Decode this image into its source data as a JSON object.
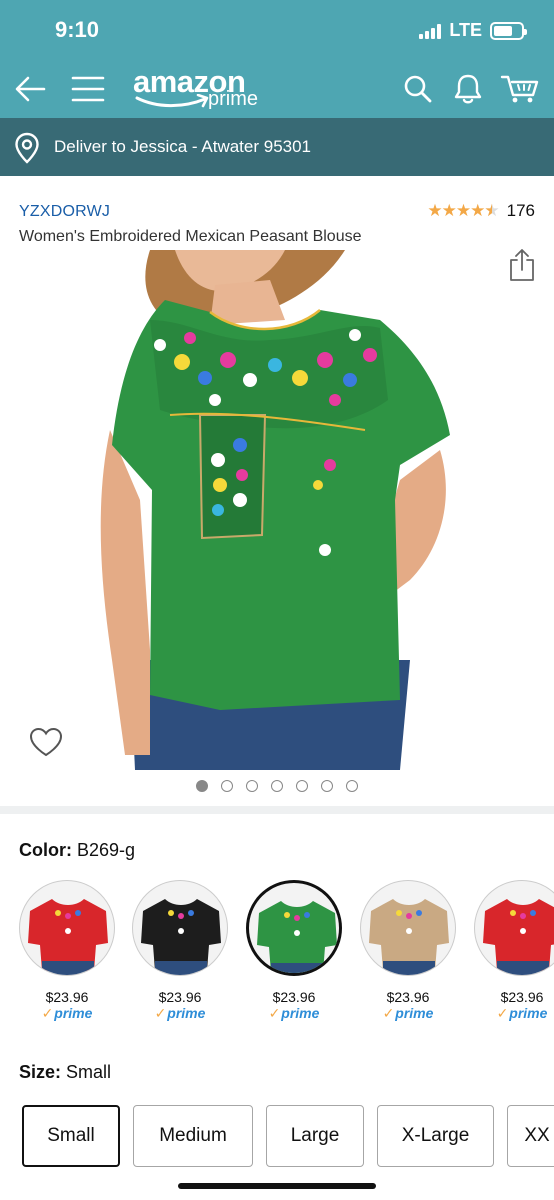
{
  "status": {
    "time": "9:10",
    "network": "LTE"
  },
  "header": {
    "logo_main": "amazon",
    "logo_sub": "prime"
  },
  "deliver": {
    "text": "Deliver to Jessica - Atwater 95301"
  },
  "product": {
    "brand": "YZXDORWJ",
    "rating_count": "176",
    "stars": 4.5,
    "title": "Women's Embroidered Mexican Peasant Blouse",
    "image_count": 7,
    "active_image": 0,
    "shirt_color": "#2e9444"
  },
  "color": {
    "label": "Color:",
    "value": "B269-g",
    "swatches": [
      {
        "price": "$23.96",
        "prime": "prime",
        "color": "#d8262b"
      },
      {
        "price": "$23.96",
        "prime": "prime",
        "color": "#1d1d1d"
      },
      {
        "price": "$23.96",
        "prime": "prime",
        "color": "#2e9444"
      },
      {
        "price": "$23.96",
        "prime": "prime",
        "color": "#c9a983"
      },
      {
        "price": "$23.96",
        "prime": "prime",
        "color": "#d8262b"
      }
    ],
    "selected_index": 2
  },
  "size": {
    "label": "Size:",
    "value": "Small",
    "options": [
      "Small",
      "Medium",
      "Large",
      "X-Large",
      "XX"
    ]
  }
}
